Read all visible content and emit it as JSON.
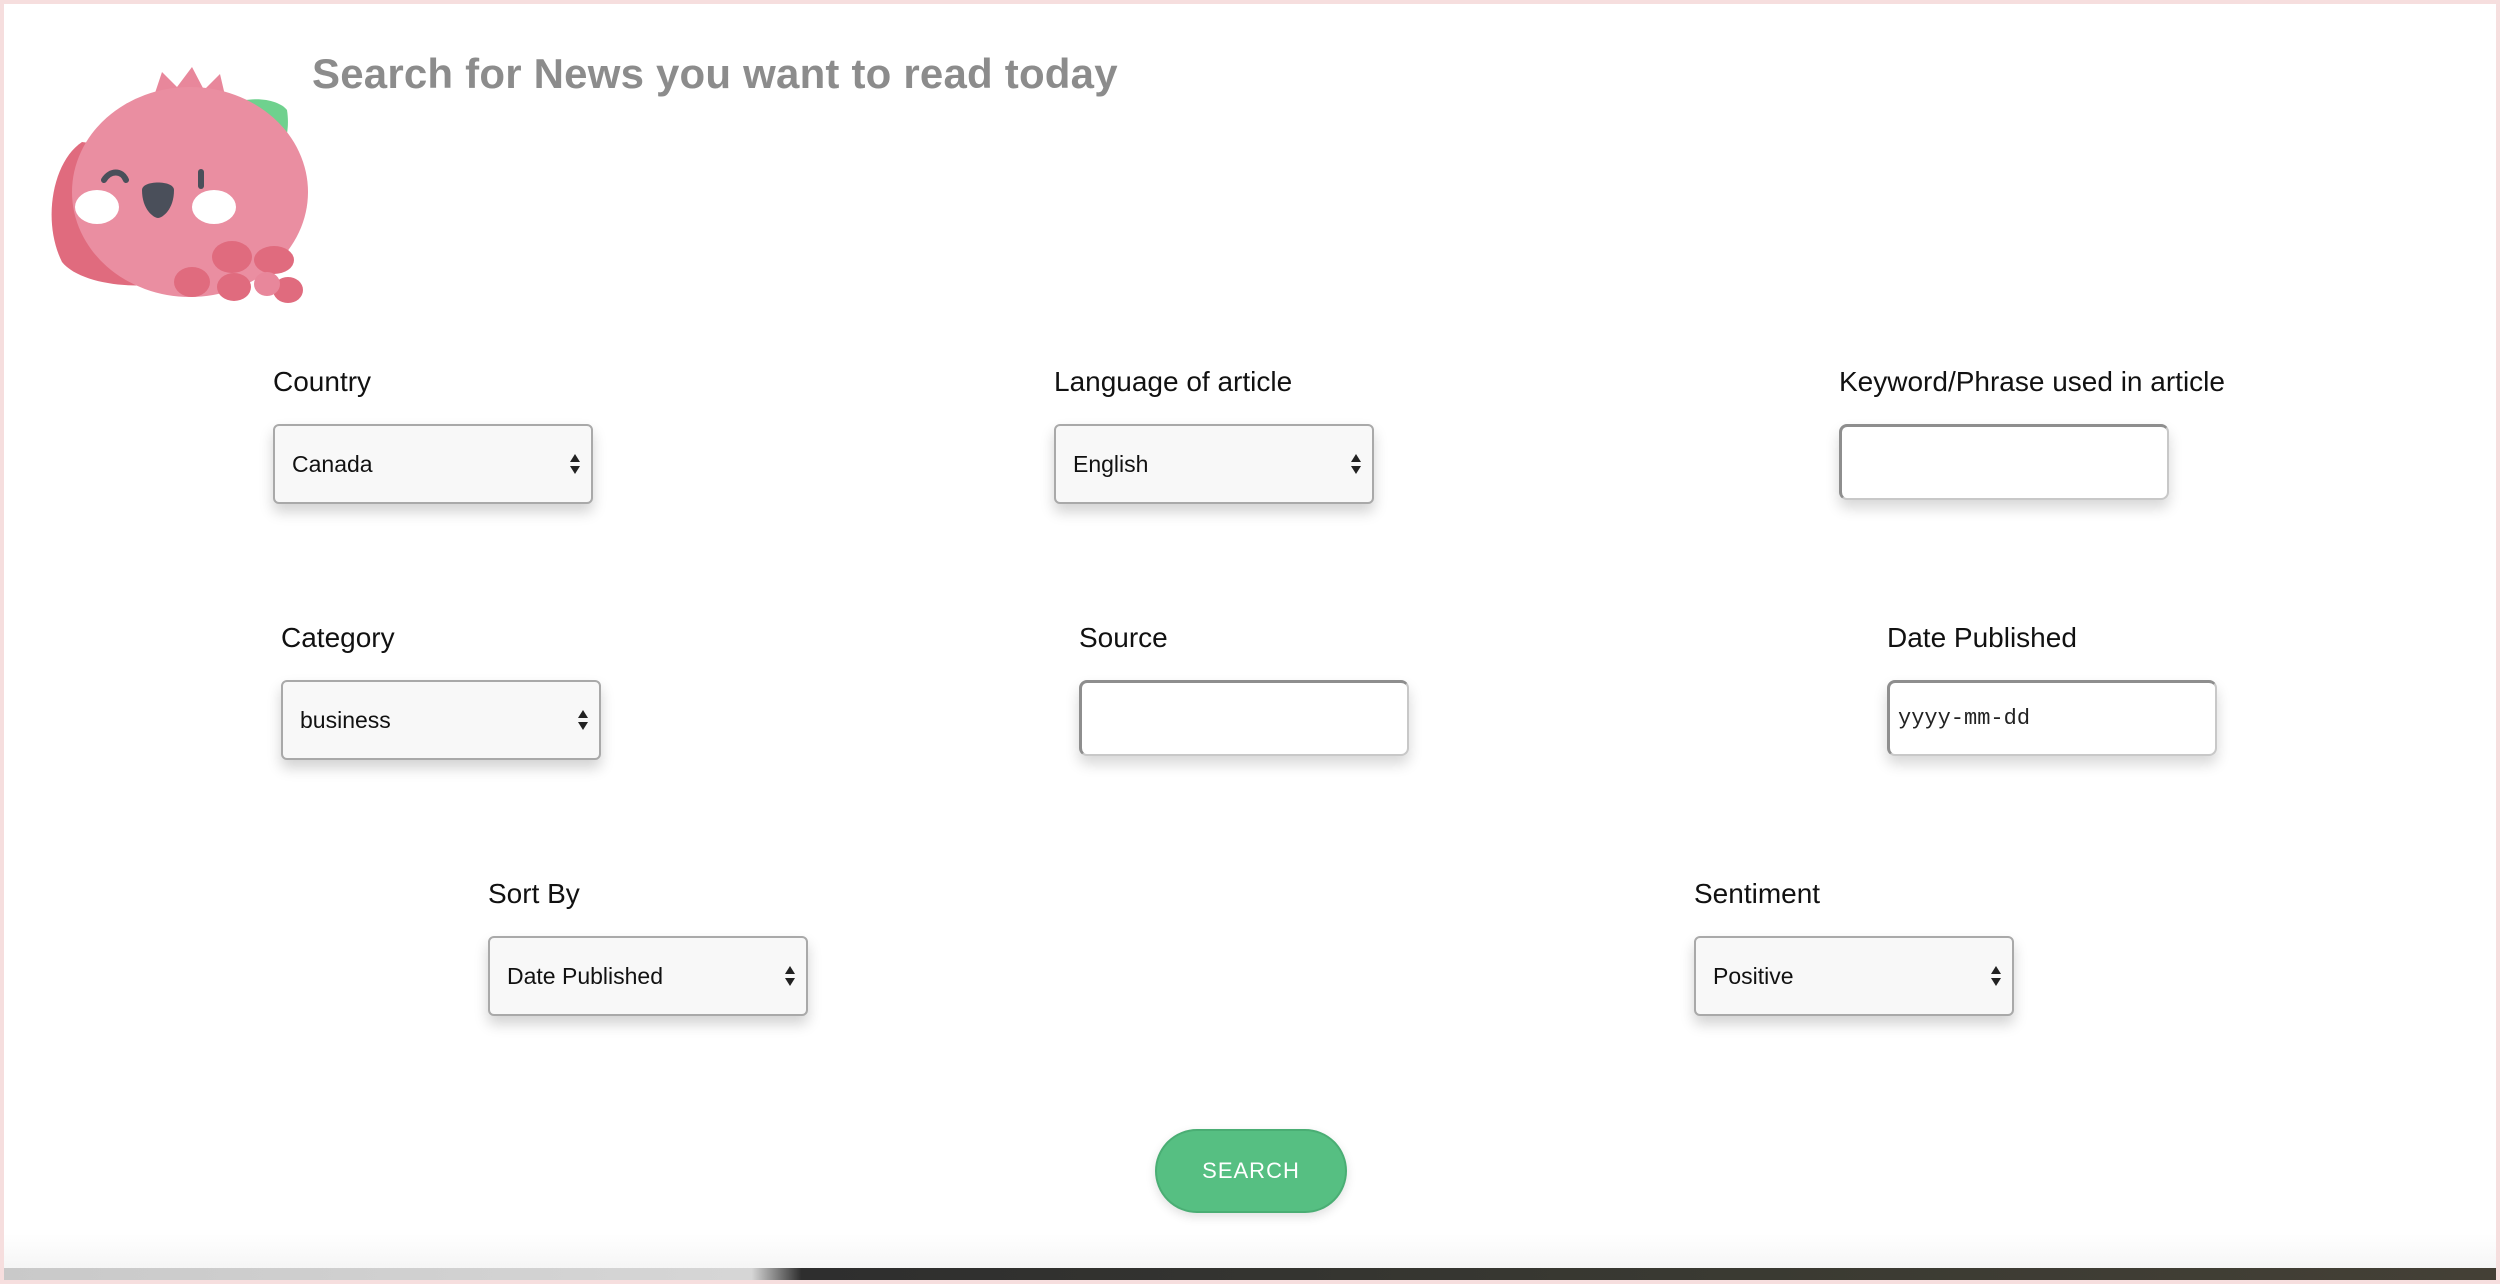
{
  "header": {
    "title": "Search for News you want to read today",
    "logo_icon": "pomegranate-mascot-icon"
  },
  "form": {
    "country": {
      "label": "Country",
      "selected": "Canada"
    },
    "language": {
      "label": "Language of article",
      "selected": "English"
    },
    "keyword": {
      "label": "Keyword/Phrase used in article",
      "value": "",
      "placeholder": ""
    },
    "category": {
      "label": "Category",
      "selected": "business"
    },
    "source": {
      "label": "Source",
      "value": "",
      "placeholder": ""
    },
    "date_published": {
      "label": "Date Published",
      "value": "",
      "placeholder": "yyyy-mm-dd"
    },
    "sort_by": {
      "label": "Sort By",
      "selected": "Date Published"
    },
    "sentiment": {
      "label": "Sentiment",
      "selected": "Positive"
    },
    "search_button": {
      "label": "SEARCH"
    }
  },
  "colors": {
    "accent": "#56bf82",
    "title": "#8c8c8c",
    "mascot_body": "#e8879b",
    "mascot_leaf": "#6fd18e"
  }
}
